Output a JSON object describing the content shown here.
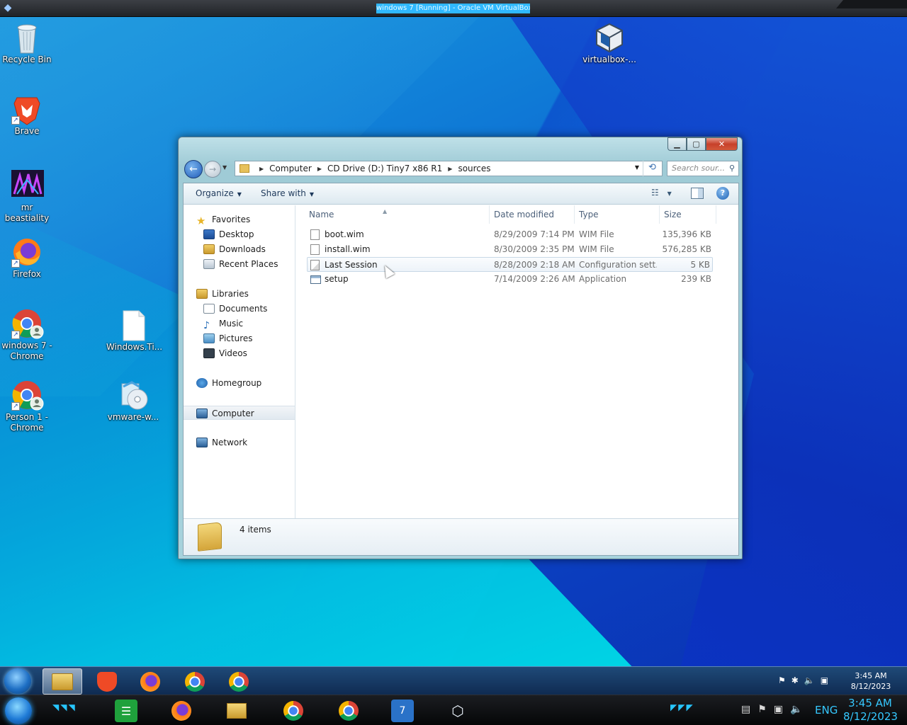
{
  "vm": {
    "title": "windows 7 [Running] - Oracle VM VirtualBox"
  },
  "desktop_icons": [
    {
      "label": "Recycle Bin"
    },
    {
      "label": "Brave"
    },
    {
      "label": "mr beastiality"
    },
    {
      "label": "Firefox"
    },
    {
      "label": "windows 7 - Chrome"
    },
    {
      "label": "Person 1 - Chrome"
    },
    {
      "label": "Windows.Ti..."
    },
    {
      "label": "vmware-w..."
    },
    {
      "label": "virtualbox-..."
    }
  ],
  "explorer": {
    "breadcrumb": [
      "Computer",
      "CD Drive (D:) Tiny7 x86 R1",
      "sources"
    ],
    "search_placeholder": "Search sour...",
    "toolbar": {
      "organize": "Organize",
      "share_with": "Share with"
    },
    "nav": {
      "favorites": "Favorites",
      "desktop": "Desktop",
      "downloads": "Downloads",
      "recent_places": "Recent Places",
      "libraries": "Libraries",
      "documents": "Documents",
      "music": "Music",
      "pictures": "Pictures",
      "videos": "Videos",
      "homegroup": "Homegroup",
      "computer": "Computer",
      "network": "Network"
    },
    "columns": {
      "name": "Name",
      "date": "Date modified",
      "type": "Type",
      "size": "Size"
    },
    "files": [
      {
        "name": "boot.wim",
        "date": "8/29/2009 7:14 PM",
        "type": "WIM File",
        "size": "135,396 KB"
      },
      {
        "name": "install.wim",
        "date": "8/30/2009 2:35 PM",
        "type": "WIM File",
        "size": "576,285 KB"
      },
      {
        "name": "Last Session",
        "date": "8/28/2009 2:18 AM",
        "type": "Configuration sett...",
        "size": "5 KB"
      },
      {
        "name": "setup",
        "date": "7/14/2009 2:26 AM",
        "type": "Application",
        "size": "239 KB"
      }
    ],
    "status": {
      "item_count": "4 items"
    }
  },
  "taskbar": {
    "time": "3:45 AM",
    "date": "8/12/2023"
  },
  "host_taskbar": {
    "time": "3:45 AM",
    "date": "8/12/2023",
    "language": "ENG"
  }
}
